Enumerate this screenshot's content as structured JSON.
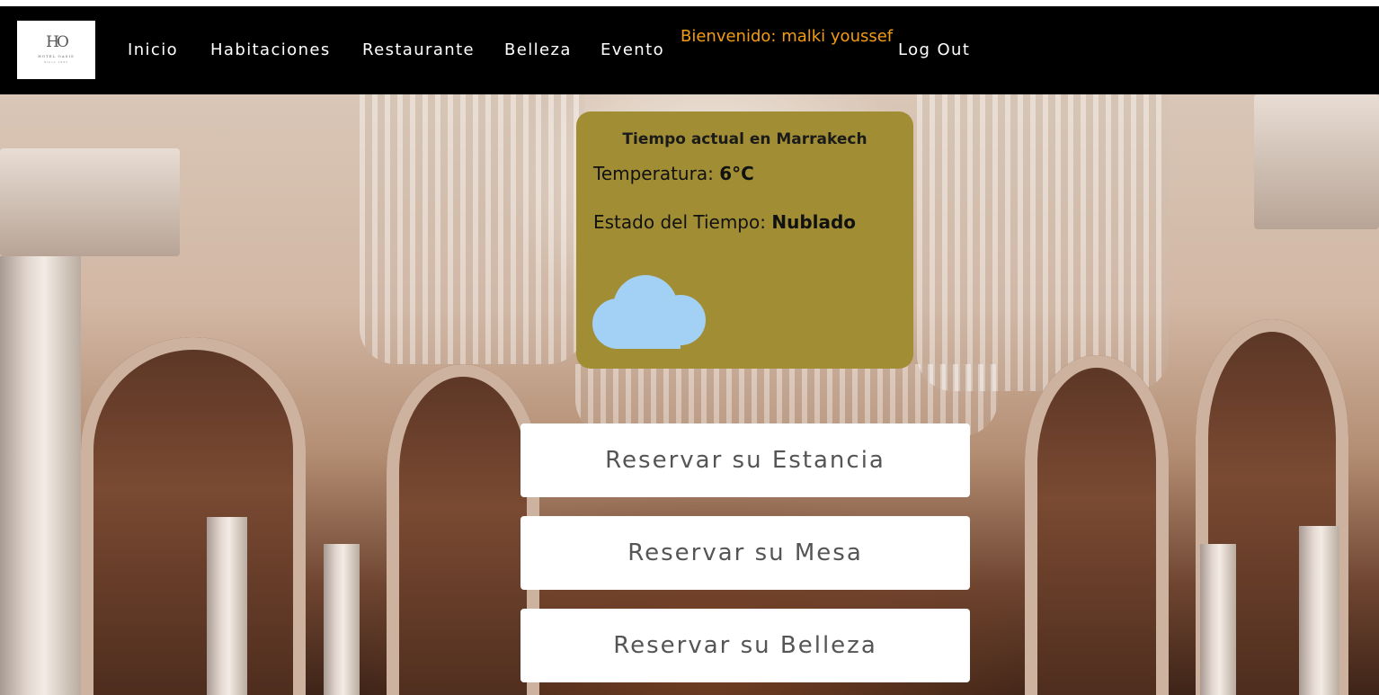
{
  "logo": {
    "monogram": "HO",
    "brand": "HOTEL OASIS",
    "since": "Since 1992"
  },
  "nav": {
    "items": [
      {
        "label": "Inicio"
      },
      {
        "label": "Habitaciones"
      },
      {
        "label": "Restaurante"
      },
      {
        "label": "Belleza"
      },
      {
        "label": "Evento"
      }
    ],
    "welcome": "Bienvenido: malki youssef",
    "logout": "Log Out"
  },
  "weather": {
    "title": "Tiempo actual en Marrakech",
    "temperature_label": "Temperatura: ",
    "temperature_value": "6°C",
    "state_label": "Estado del Tiempo: ",
    "state_value": "Nublado",
    "icon": "cloud-icon",
    "card_color": "#a18e34",
    "cloud_color": "#a3d1f5"
  },
  "buttons": {
    "stay": "Reservar su Estancia",
    "table": "Reservar su Mesa",
    "beauty": "Reservar su Belleza"
  },
  "colors": {
    "navbar": "#000000",
    "welcome": "#f39c12",
    "button_text": "#555555"
  }
}
